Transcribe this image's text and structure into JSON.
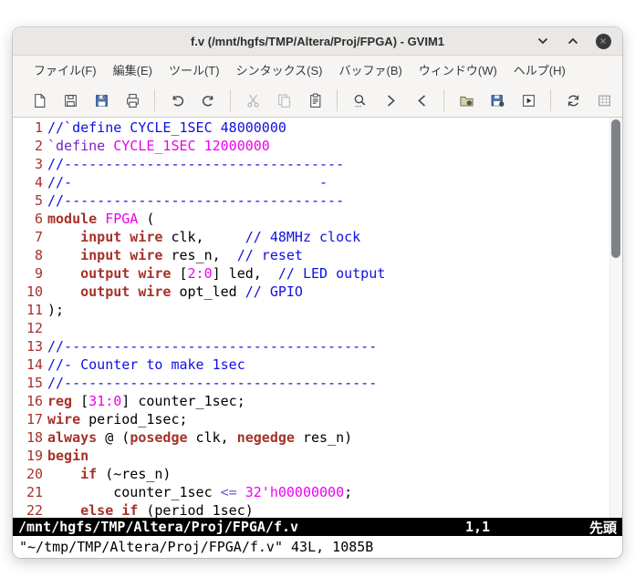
{
  "window": {
    "title": "f.v (/mnt/hgfs/TMP/Altera/Proj/FPGA) - GVIM1"
  },
  "menu": {
    "items": [
      {
        "id": "file",
        "label": "ファイル(F)"
      },
      {
        "id": "edit",
        "label": "編集(E)"
      },
      {
        "id": "tools",
        "label": "ツール(T)"
      },
      {
        "id": "syntax",
        "label": "シンタックス(S)"
      },
      {
        "id": "buffers",
        "label": "バッファ(B)"
      },
      {
        "id": "window",
        "label": "ウィンドウ(W)"
      },
      {
        "id": "help",
        "label": "ヘルプ(H)"
      }
    ]
  },
  "toolbar": {
    "groups": [
      {
        "buttons": [
          {
            "icon": "new-file",
            "enabled": true
          },
          {
            "icon": "save",
            "enabled": true
          },
          {
            "icon": "save-all",
            "enabled": true
          },
          {
            "icon": "print",
            "enabled": true
          }
        ]
      },
      {
        "buttons": [
          {
            "icon": "undo",
            "enabled": true
          },
          {
            "icon": "redo",
            "enabled": true
          }
        ]
      },
      {
        "buttons": [
          {
            "icon": "cut",
            "enabled": false
          },
          {
            "icon": "copy",
            "enabled": false
          },
          {
            "icon": "paste",
            "enabled": true
          }
        ]
      },
      {
        "buttons": [
          {
            "icon": "find",
            "enabled": true
          },
          {
            "icon": "find-next",
            "enabled": true
          },
          {
            "icon": "find-prev",
            "enabled": true
          }
        ]
      },
      {
        "buttons": [
          {
            "icon": "load-session",
            "enabled": true
          },
          {
            "icon": "save-session",
            "enabled": true
          },
          {
            "icon": "run-script",
            "enabled": true
          }
        ]
      },
      {
        "buttons": [
          {
            "icon": "make",
            "enabled": true
          },
          {
            "icon": "run-ctags",
            "enabled": true
          },
          {
            "icon": "tag-jump",
            "enabled": true
          }
        ]
      },
      {
        "buttons": [
          {
            "icon": "help",
            "enabled": true
          },
          {
            "icon": "find-help",
            "enabled": true
          }
        ]
      }
    ]
  },
  "editor": {
    "lines": [
      {
        "num": "1",
        "segs": [
          [
            "c",
            "//`define CYCLE_1SEC 48000000"
          ]
        ]
      },
      {
        "num": "2",
        "segs": [
          [
            "p",
            "`define"
          ],
          [
            "n",
            " "
          ],
          [
            "m",
            "CYCLE_1SEC 12000000"
          ]
        ]
      },
      {
        "num": "3",
        "segs": [
          [
            "c",
            "//----------------------------------"
          ]
        ]
      },
      {
        "num": "4",
        "segs": [
          [
            "c",
            "//-                              -"
          ]
        ]
      },
      {
        "num": "5",
        "segs": [
          [
            "c",
            "//----------------------------------"
          ]
        ]
      },
      {
        "num": "6",
        "segs": [
          [
            "k",
            "module"
          ],
          [
            "n",
            " "
          ],
          [
            "m",
            "FPGA"
          ],
          [
            "n",
            " ("
          ]
        ]
      },
      {
        "num": "7",
        "segs": [
          [
            "n",
            "    "
          ],
          [
            "k",
            "input wire"
          ],
          [
            "n",
            " clk,     "
          ],
          [
            "c",
            "// 48MHz clock"
          ]
        ]
      },
      {
        "num": "8",
        "segs": [
          [
            "n",
            "    "
          ],
          [
            "k",
            "input wire"
          ],
          [
            "n",
            " res_n,  "
          ],
          [
            "c",
            "// reset"
          ]
        ]
      },
      {
        "num": "9",
        "segs": [
          [
            "n",
            "    "
          ],
          [
            "k",
            "output wire"
          ],
          [
            "n",
            " ["
          ],
          [
            "m",
            "2:0"
          ],
          [
            "n",
            "] led,  "
          ],
          [
            "c",
            "// LED output"
          ]
        ]
      },
      {
        "num": "10",
        "segs": [
          [
            "n",
            "    "
          ],
          [
            "k",
            "output wire"
          ],
          [
            "n",
            " opt_led "
          ],
          [
            "c",
            "// GPIO"
          ]
        ]
      },
      {
        "num": "11",
        "segs": [
          [
            "n",
            ");"
          ]
        ]
      },
      {
        "num": "12",
        "segs": []
      },
      {
        "num": "13",
        "segs": [
          [
            "c",
            "//--------------------------------------"
          ]
        ]
      },
      {
        "num": "14",
        "segs": [
          [
            "c",
            "//- Counter to make 1sec"
          ]
        ]
      },
      {
        "num": "15",
        "segs": [
          [
            "c",
            "//--------------------------------------"
          ]
        ]
      },
      {
        "num": "16",
        "segs": [
          [
            "k",
            "reg"
          ],
          [
            "n",
            " ["
          ],
          [
            "m",
            "31:0"
          ],
          [
            "n",
            "] counter_1sec;"
          ]
        ]
      },
      {
        "num": "17",
        "segs": [
          [
            "k",
            "wire"
          ],
          [
            "n",
            " period_1sec;"
          ]
        ]
      },
      {
        "num": "18",
        "segs": [
          [
            "k",
            "always"
          ],
          [
            "n",
            " @ ("
          ],
          [
            "k",
            "posedge"
          ],
          [
            "n",
            " clk, "
          ],
          [
            "k",
            "negedge"
          ],
          [
            "n",
            " res_n)"
          ]
        ]
      },
      {
        "num": "19",
        "segs": [
          [
            "k",
            "begin"
          ]
        ]
      },
      {
        "num": "20",
        "segs": [
          [
            "n",
            "    "
          ],
          [
            "k",
            "if"
          ],
          [
            "n",
            " (~res_n)"
          ]
        ]
      },
      {
        "num": "21",
        "segs": [
          [
            "n",
            "        counter_1sec "
          ],
          [
            "s",
            "<="
          ],
          [
            "n",
            " "
          ],
          [
            "m",
            "32'h00000000"
          ],
          [
            "n",
            ";"
          ]
        ]
      },
      {
        "num": "22",
        "segs": [
          [
            "n",
            "    "
          ],
          [
            "k",
            "else"
          ],
          [
            "n",
            " "
          ],
          [
            "k",
            "if"
          ],
          [
            "n",
            " (period_1sec)"
          ]
        ]
      }
    ]
  },
  "statusbar": {
    "file": "/mnt/hgfs/TMP/Altera/Proj/FPGA/f.v",
    "ruler": "1,1",
    "position_label": "先頭"
  },
  "cmdline": {
    "text": "\"~/tmp/TMP/Altera/Proj/FPGA/f.v\" 43L, 1085B"
  },
  "colors": {
    "chrome-bg": "#f6f5f4",
    "titlebar-bg": "#eae8e6",
    "editor-bg": "#ffffff",
    "keyword": "#a5322a",
    "comment": "#1010e0",
    "constant": "#ee00ee",
    "preproc": "#7d20c0",
    "special": "#6a5acd",
    "line-number": "#a5322a",
    "status-bg": "#000000",
    "status-fg": "#ffffff"
  }
}
